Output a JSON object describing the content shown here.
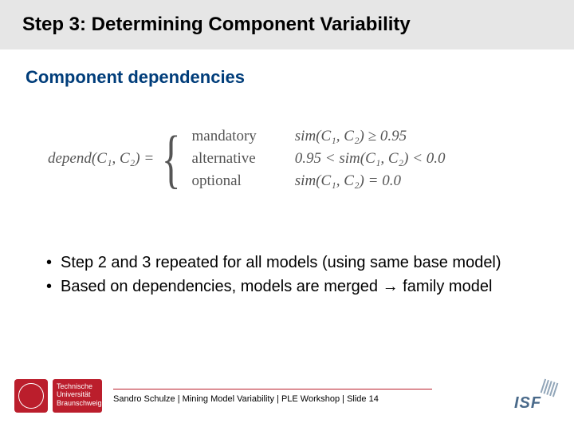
{
  "title": "Step 3: Determining Component Variability",
  "subtitle": "Component dependencies",
  "formula": {
    "lhs": "depend(C₁, C₂) =",
    "cases": [
      "mandatory",
      "alternative",
      "optional"
    ],
    "conditions": [
      "sim(C₁, C₂) ≥ 0.95",
      "0.95 < sim(C₁, C₂) < 0.0",
      "sim(C₁, C₂) = 0.0"
    ]
  },
  "bullets": [
    "Step 2 and 3 repeated for all models (using same base model)",
    "Based on dependencies, models are merged → family model"
  ],
  "footer": {
    "uni_line1": "Technische",
    "uni_line2": "Universität",
    "uni_line3": "Braunschweig",
    "text": "Sandro Schulze | Mining Model Variability | PLE Workshop | Slide 14",
    "isf": "ISF"
  }
}
